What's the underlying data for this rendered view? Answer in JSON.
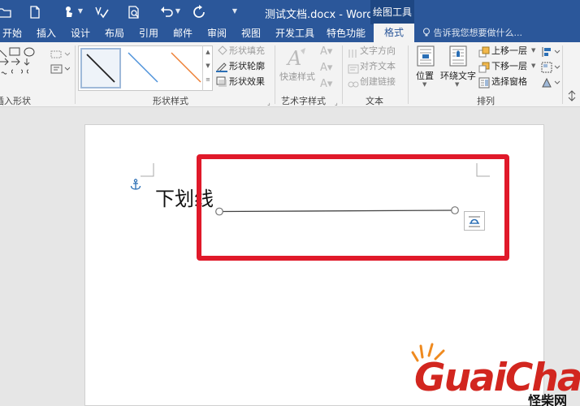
{
  "titlebar": {
    "doc_title": "测试文档.docx - Word",
    "context_tab": "绘图工具"
  },
  "tabs": [
    "开始",
    "插入",
    "设计",
    "布局",
    "引用",
    "邮件",
    "审阅",
    "视图",
    "开发工具",
    "特色功能"
  ],
  "active_tab": "格式",
  "tell_me": "告诉我您想要做什么...",
  "ribbon": {
    "insert_shapes_label": "插入形状",
    "shape_styles_label": "形状样式",
    "shape_fill": "形状填充",
    "shape_outline": "形状轮廓",
    "shape_effects": "形状效果",
    "wordart_quick": "快速样式",
    "wordart_label": "艺术字样式",
    "text_direction": "文字方向",
    "align_text": "对齐文本",
    "create_link": "创建链接",
    "text_label": "文本",
    "position": "位置",
    "wrap_text": "环绕文字",
    "bring_forward": "上移一层",
    "send_backward": "下移一层",
    "selection_pane": "选择窗格",
    "arrange_label": "排列"
  },
  "gallery_colors": [
    "#222222",
    "#4a90d9",
    "#ed7d31"
  ],
  "document": {
    "body_text": "下划线"
  },
  "watermark": {
    "main": "GuaiChai",
    "sub": "怪柴网"
  },
  "colors": {
    "title_bar": "#2b579a",
    "highlight": "#e0192a",
    "watermark_red": "#d2261f"
  }
}
